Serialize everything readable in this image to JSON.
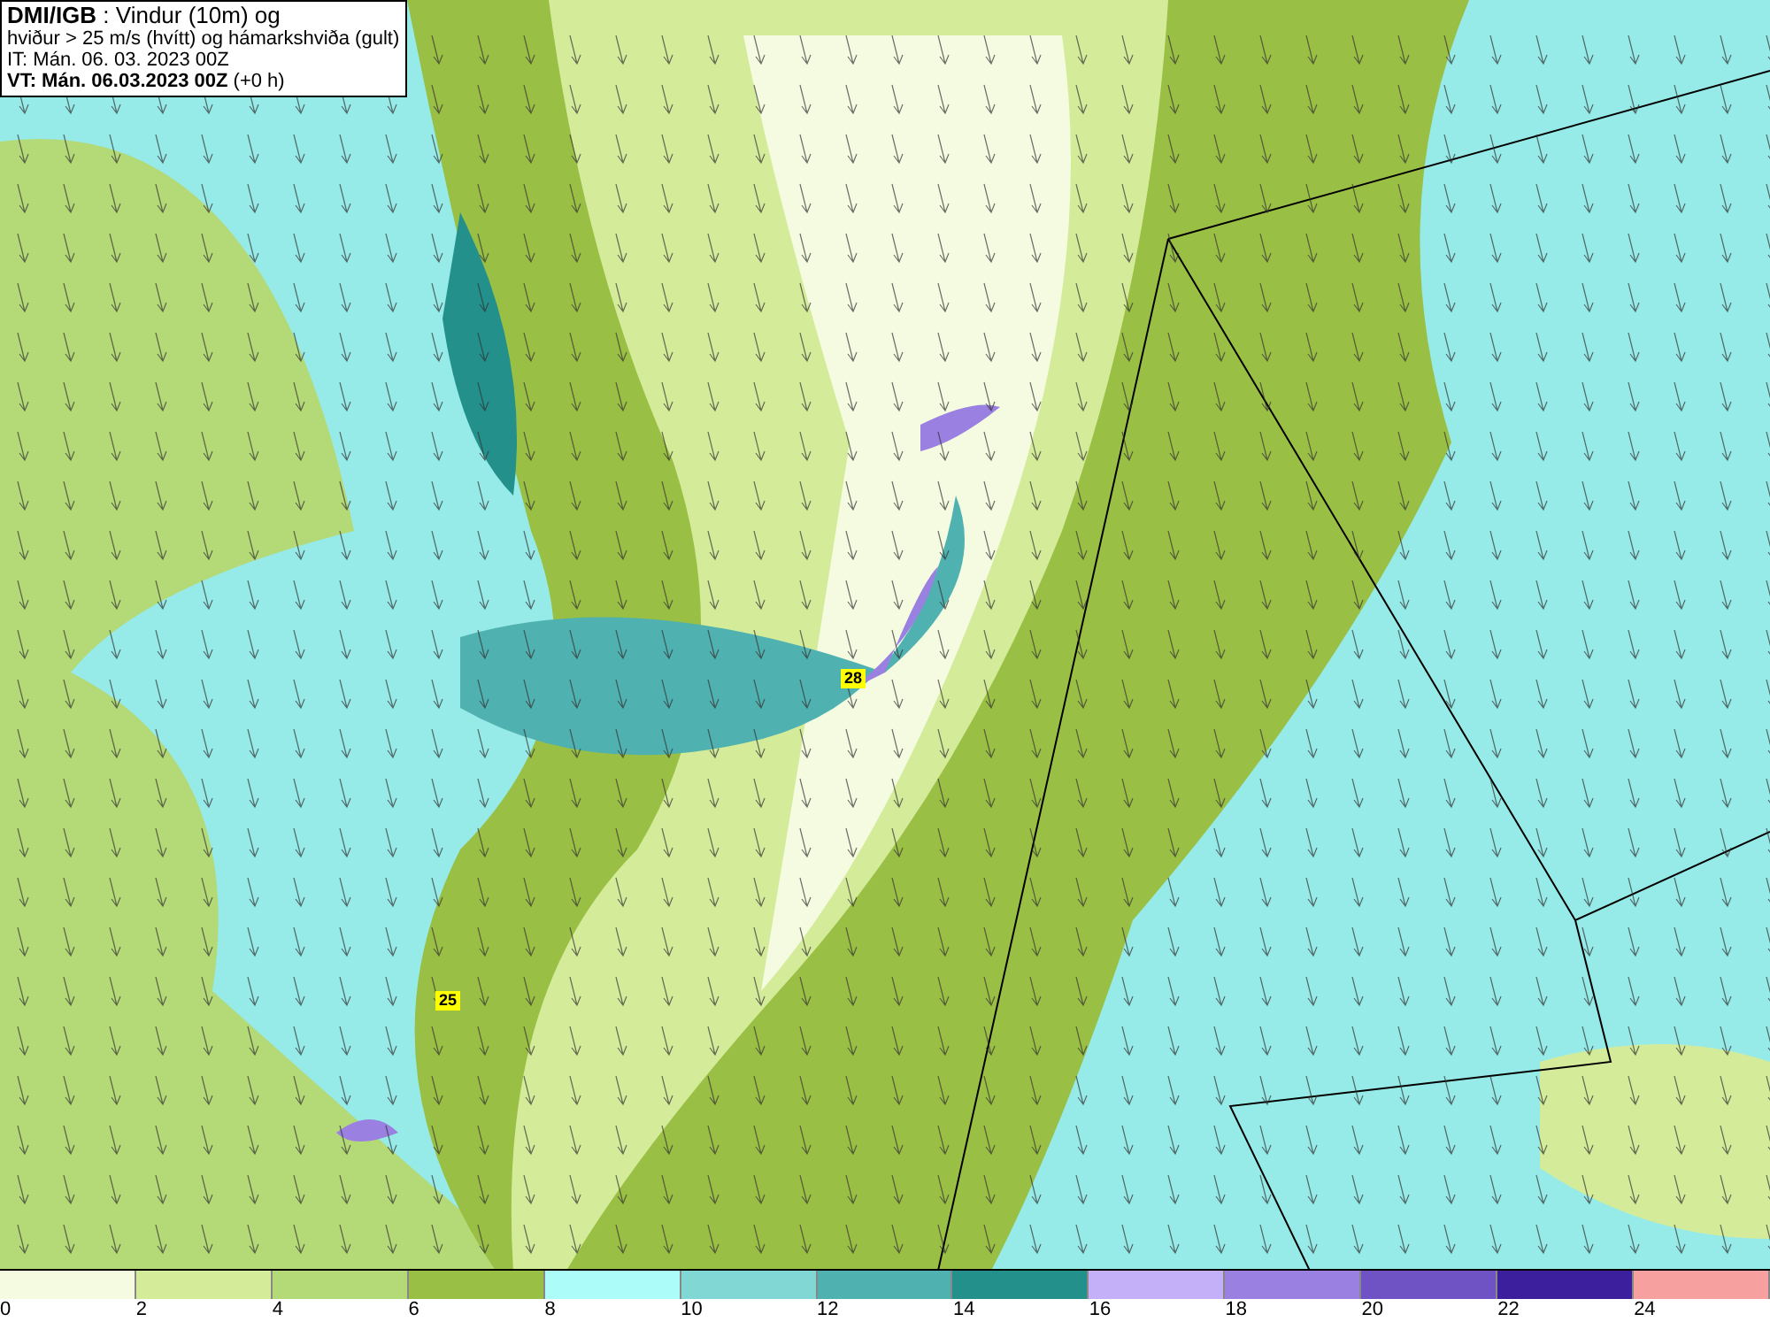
{
  "title_box": {
    "lines": [
      "**DMI/IGB** : Vindur (10m) og",
      "hviður > 25 m/s (hvítt) og hámarkshviða (gult)",
      "IT: Mán. 06. 03. 2023 00Z",
      "**VT: Mán. 06.03.2023 00Z** (+0 h)"
    ]
  },
  "map": {
    "maxima": [
      "28",
      "25"
    ]
  },
  "legend": [
    {
      "label": "0",
      "color": "#f4fbe0"
    },
    {
      "label": "2",
      "color": "#d4ec9a"
    },
    {
      "label": "4",
      "color": "#b4d977"
    },
    {
      "label": "6",
      "color": "#9abf45"
    },
    {
      "label": "8",
      "color": "#acfcfa"
    },
    {
      "label": "10",
      "color": "#80d7d4"
    },
    {
      "label": "12",
      "color": "#50b2b0"
    },
    {
      "label": "14",
      "color": "#23908c"
    },
    {
      "label": "16",
      "color": "#c4b0f8"
    },
    {
      "label": "18",
      "color": "#9a80e0"
    },
    {
      "label": "20",
      "color": "#6f52c4"
    },
    {
      "label": "22",
      "color": "#3c1f9c"
    },
    {
      "label": "24",
      "color": "#f7a0a0"
    }
  ]
}
